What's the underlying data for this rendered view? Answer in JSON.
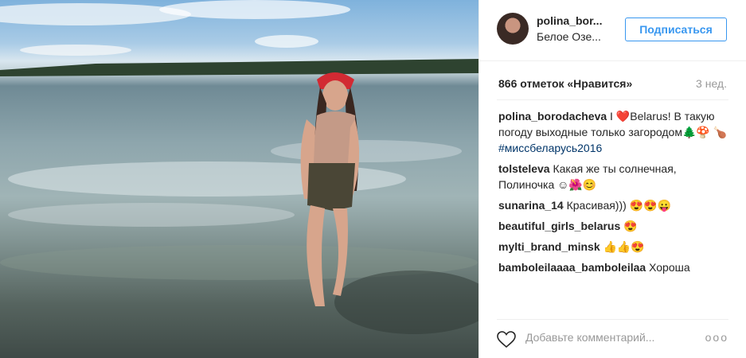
{
  "post": {
    "username": "polina_bor...",
    "location": "Белое Озе...",
    "follow_label": "Подписаться",
    "likes": "866 отметок «Нравится»",
    "time": "3 нед."
  },
  "comments": [
    {
      "user": "polina_borodacheva",
      "text": "I ❤️Belarus! В такую погоду выходные только загородом🌲🍄",
      "hashtag": "🍗#миссбеларусь2016"
    },
    {
      "user": "tolsteleva",
      "text": "Какая же ты солнечная, Полиночка ☺🌺😊"
    },
    {
      "user": "sunarina_14",
      "text": "Красивая))) 😍😍😛"
    },
    {
      "user": "beautiful_girls_belarus",
      "text": "😍"
    },
    {
      "user": "mylti_brand_minsk",
      "text": "👍👍😍"
    },
    {
      "user": "bamboleilaaaa_bamboleilaa",
      "text": "Хороша"
    }
  ],
  "add_comment": {
    "placeholder": "Добавьте комментарий...",
    "more": "ооо"
  }
}
